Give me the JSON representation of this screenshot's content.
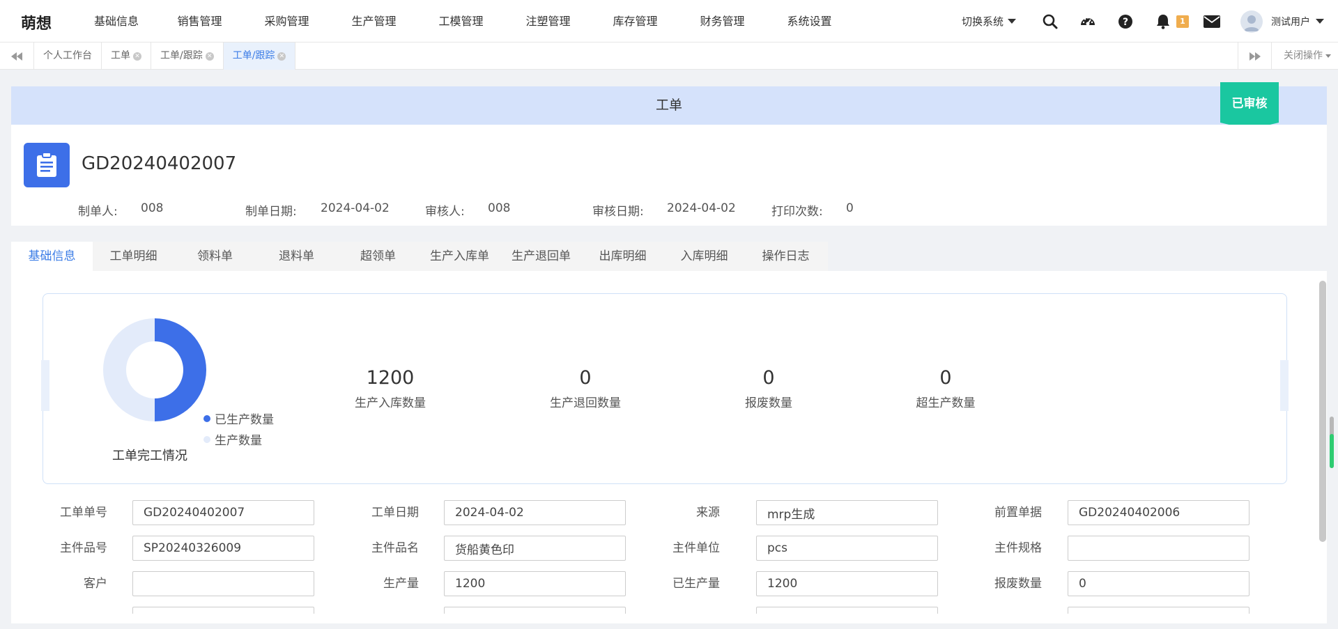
{
  "app": {
    "logo": "萌想",
    "menu": [
      "基础信息",
      "销售管理",
      "采购管理",
      "生产管理",
      "工模管理",
      "注塑管理",
      "库存管理",
      "财务管理",
      "系统设置"
    ],
    "switch_system": "切换系统",
    "notification_count": "1",
    "user_name": "测试用户"
  },
  "tabbar": {
    "tabs": [
      "个人工作台",
      "工单",
      "工单/跟踪",
      "工单/跟踪"
    ],
    "active_index": 3,
    "close_ops": "关闭操作"
  },
  "doc": {
    "title": "工单",
    "stamp": "已审核",
    "number": "GD20240402007",
    "meta": {
      "maker_label": "制单人:",
      "maker": "008",
      "make_date_label": "制单日期:",
      "make_date": "2024-04-02",
      "reviewer_label": "审核人:",
      "reviewer": "008",
      "review_date_label": "审核日期:",
      "review_date": "2024-04-02",
      "print_count_label": "打印次数:",
      "print_count": "0"
    }
  },
  "section_tabs": [
    "基础信息",
    "工单明细",
    "领料单",
    "退料单",
    "超领单",
    "生产入库单",
    "生产退回单",
    "出库明细",
    "入库明细",
    "操作日志"
  ],
  "stats": {
    "chart_title": "工单完工情况",
    "items": [
      {
        "value": "1200",
        "label": "生产入库数量"
      },
      {
        "value": "0",
        "label": "生产退回数量"
      },
      {
        "value": "0",
        "label": "报废数量"
      },
      {
        "value": "0",
        "label": "超生产数量"
      }
    ]
  },
  "chart_data": {
    "type": "pie",
    "title": "工单完工情况",
    "categories": [
      "已生产数量",
      "生产数量"
    ],
    "values": [
      1200,
      1200
    ],
    "colors": [
      "#3d6fe8",
      "#e3ebfa"
    ],
    "legend": "bottom-right"
  },
  "form": {
    "rows": [
      [
        {
          "label": "工单单号",
          "value": "GD20240402007"
        },
        {
          "label": "工单日期",
          "value": "2024-04-02"
        },
        {
          "label": "来源",
          "value": "mrp生成"
        },
        {
          "label": "前置单据",
          "value": "GD20240402006"
        }
      ],
      [
        {
          "label": "主件品号",
          "value": "SP20240326009"
        },
        {
          "label": "主件品名",
          "value": "货船黄色印"
        },
        {
          "label": "主件单位",
          "value": "pcs"
        },
        {
          "label": "主件规格",
          "value": ""
        }
      ],
      [
        {
          "label": "客户",
          "value": ""
        },
        {
          "label": "生产量",
          "value": "1200"
        },
        {
          "label": "已生产量",
          "value": "1200"
        },
        {
          "label": "报废数量",
          "value": "0"
        }
      ]
    ]
  },
  "colors": {
    "accent": "#3b7ce6",
    "stamp": "#1ac7a0",
    "band": "#d5e2fb",
    "doc_icon": "#3d6fe8"
  }
}
